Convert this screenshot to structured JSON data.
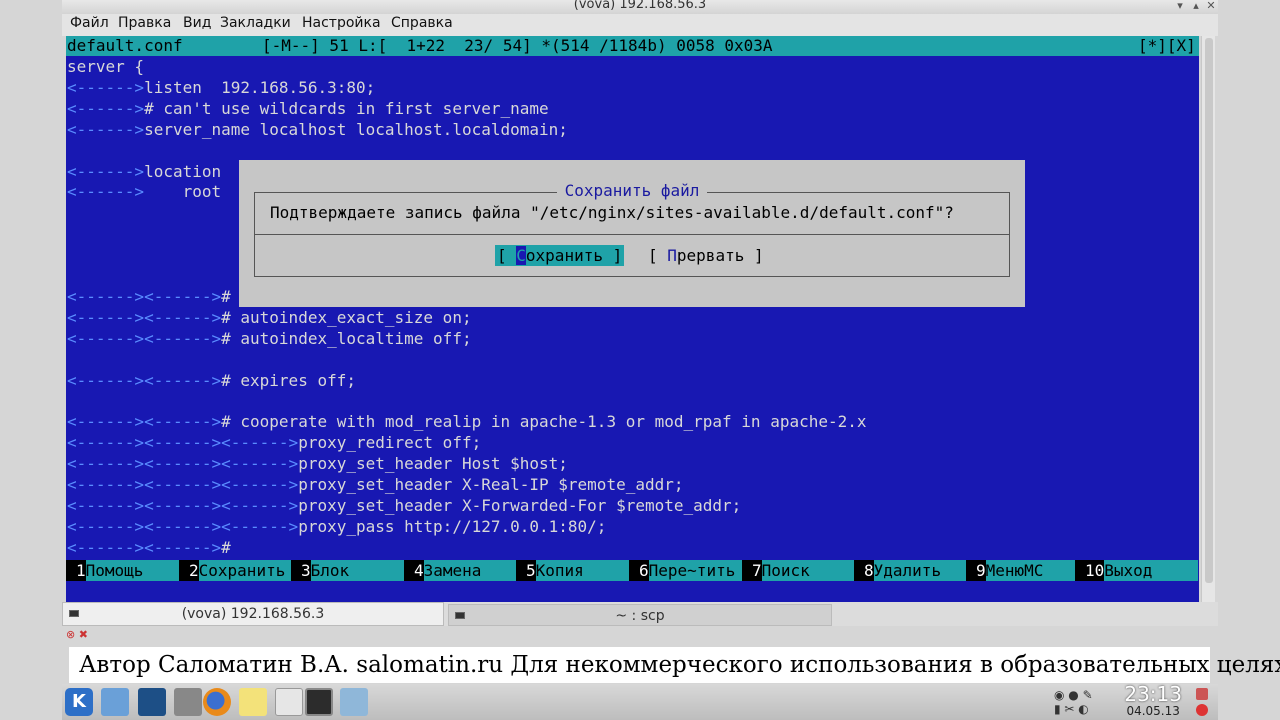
{
  "window": {
    "title": "(vova) 192.168.56.3",
    "menu": [
      "Файл",
      "Правка",
      "Вид",
      "Закладки",
      "Настройка",
      "Справка"
    ]
  },
  "editor": {
    "status_left": "default.conf",
    "status_mid": "[-M--] 51 L:[  1+22  23/ 54] *(514 /1184b) 0058 0x03A",
    "status_right": "[*][X]",
    "lines": [
      {
        "tab": "",
        "text": "server {"
      },
      {
        "tab": "<------>",
        "text": "listen  192.168.56.3:80;"
      },
      {
        "tab": "<------>",
        "text": "# can't use wildcards in first server_name"
      },
      {
        "tab": "<------>",
        "text": "server_name localhost localhost.localdomain;"
      },
      {
        "tab": "",
        "text": ""
      },
      {
        "tab": "<------>",
        "text": "location"
      },
      {
        "tab": "<------>",
        "text": "    root"
      },
      {
        "tab": "",
        "text": ""
      },
      {
        "tab": "",
        "text": ""
      },
      {
        "tab": "",
        "text": ""
      },
      {
        "tab": "",
        "text": ""
      },
      {
        "tab": "<------><------>",
        "text": "#"
      },
      {
        "tab": "<------><------>",
        "text": "# autoindex_exact_size on;"
      },
      {
        "tab": "<------><------>",
        "text": "# autoindex_localtime off;"
      },
      {
        "tab": "",
        "text": ""
      },
      {
        "tab": "<------><------>",
        "text": "# expires off;"
      },
      {
        "tab": "",
        "text": ""
      },
      {
        "tab": "<------><------>",
        "text": "# cooperate with mod_realip in apache-1.3 or mod_rpaf in apache-2.x"
      },
      {
        "tab": "<------><------><------>",
        "text": "proxy_redirect off;"
      },
      {
        "tab": "<------><------><------>",
        "text": "proxy_set_header Host $host;"
      },
      {
        "tab": "<------><------><------>",
        "text": "proxy_set_header X-Real-IP $remote_addr;"
      },
      {
        "tab": "<------><------><------>",
        "text": "proxy_set_header X-Forwarded-For $remote_addr;"
      },
      {
        "tab": "<------><------><------>",
        "text": "proxy_pass http://127.0.0.1:80/;"
      },
      {
        "tab": "<------><------>",
        "text": "#"
      }
    ]
  },
  "dialog": {
    "title": "Сохранить файл",
    "message": "Подтверждаете запись файла \"/etc/nginx/sites-available.d/default.conf\"?",
    "save_pre": "[ ",
    "save_hot": "С",
    "save_rest": "охранить ]",
    "abort_pre": "[ ",
    "abort_hot": "П",
    "abort_rest": "рервать ]"
  },
  "fkeys": [
    {
      "num": "1",
      "label": "Помощь"
    },
    {
      "num": "2",
      "label": "Сохранить"
    },
    {
      "num": "3",
      "label": "Блок"
    },
    {
      "num": "4",
      "label": "Замена"
    },
    {
      "num": "5",
      "label": "Копия"
    },
    {
      "num": "6",
      "label": "Пере~тить"
    },
    {
      "num": "7",
      "label": "Поиск"
    },
    {
      "num": "8",
      "label": "Удалить"
    },
    {
      "num": "9",
      "label": "МенюMC"
    },
    {
      "num": "10",
      "label": "Выход"
    }
  ],
  "tabs": [
    {
      "label": "(vova) 192.168.56.3"
    },
    {
      "label": "~ : scp"
    }
  ],
  "caption": "Автор Саломатин В.А. salomatin.ru Для некоммерческого использования в образовательных целях.",
  "taskbar": {
    "kde_label": "K",
    "time": "23:13",
    "date": "04.05.13"
  }
}
